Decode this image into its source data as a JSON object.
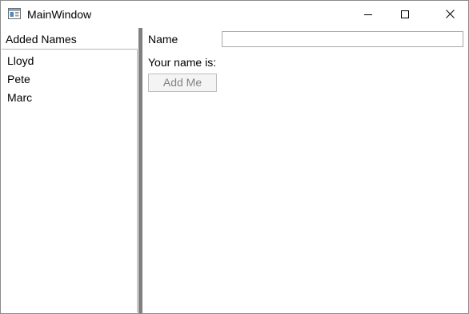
{
  "window": {
    "title": "MainWindow",
    "app_icon": "wpf-window-icon",
    "controls": {
      "minimize_icon": "minimize-icon",
      "maximize_icon": "maximize-icon",
      "close_icon": "close-icon"
    }
  },
  "left_panel": {
    "header": "Added Names",
    "names": [
      "Lloyd",
      "Pete",
      "Marc"
    ]
  },
  "right_panel": {
    "name_label": "Name",
    "name_value": "",
    "your_name_label": "Your name is:",
    "add_button_label": "Add Me",
    "add_button_enabled": false
  },
  "colors": {
    "splitter": "#808080",
    "window_border": "#8a8a8a",
    "disabled_text": "#838383"
  }
}
